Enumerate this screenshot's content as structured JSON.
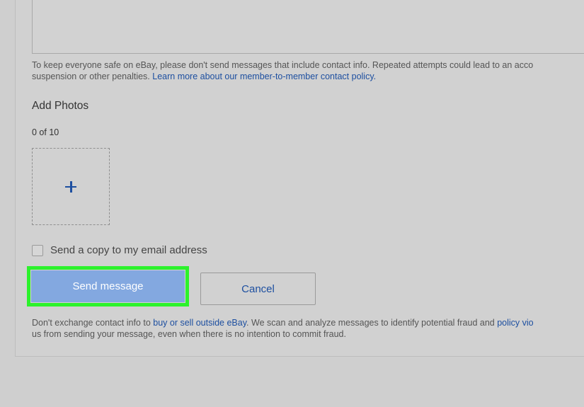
{
  "notice": {
    "line1": "To keep everyone safe on eBay, please don't send messages that include contact info. Repeated attempts could lead to an acco",
    "line2_text": "suspension or other penalties. ",
    "line2_link": "Learn more about our member-to-member contact policy."
  },
  "photos": {
    "title": "Add Photos",
    "count": "0 of 10",
    "add_symbol": "+"
  },
  "copy_option": {
    "label": "Send a copy to my email address",
    "checked": false
  },
  "buttons": {
    "send": "Send message",
    "cancel": "Cancel"
  },
  "footer": {
    "line1_pre": "Don't exchange contact info to ",
    "line1_link1": "buy or sell outside eBay",
    "line1_mid": ". We scan and analyze messages to identify potential fraud and ",
    "line1_link2": "policy vio",
    "line2": "us from sending your message, even when there is no intention to commit fraud."
  },
  "colors": {
    "background": "#cfcfcf",
    "link": "#1d4fa0",
    "send_button": "#83a8e0",
    "highlight": "#2cf22c"
  }
}
